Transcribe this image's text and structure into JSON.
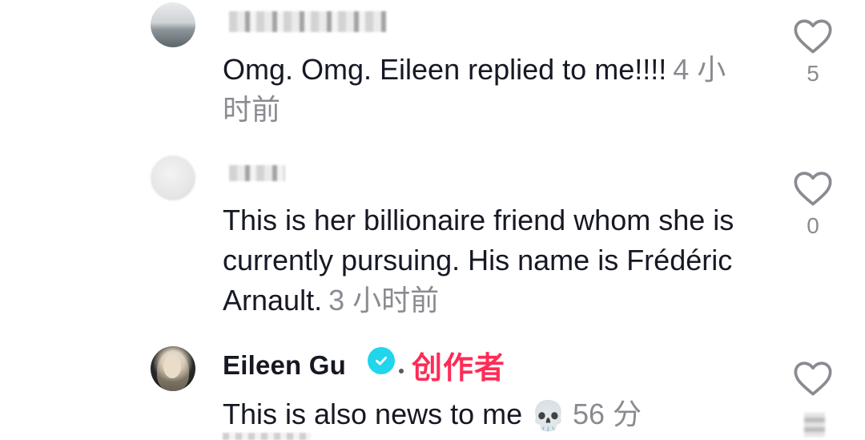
{
  "comments": [
    {
      "username": "",
      "text": "Omg. Omg. Eileen replied to me!!!!",
      "time": "4 小时前",
      "likes": "5"
    },
    {
      "username": "",
      "text": "This is her billionaire friend whom she is currently pursuing. His name is Frédéric Arnault.",
      "time": "3 小时前",
      "likes": "0"
    },
    {
      "username": "Eileen Gu",
      "creator_label": "创作者",
      "text": "This is also news to me",
      "emoji": "💀",
      "time": "56 分",
      "likes": ""
    }
  ],
  "icons": {
    "like": "heart-outline-icon",
    "verified": "verified-badge-icon",
    "skull": "skull-emoji"
  },
  "colors": {
    "text": "#161823",
    "secondary": "#8a8b91",
    "creator": "#fe2c55",
    "verified": "#20d5ec"
  }
}
